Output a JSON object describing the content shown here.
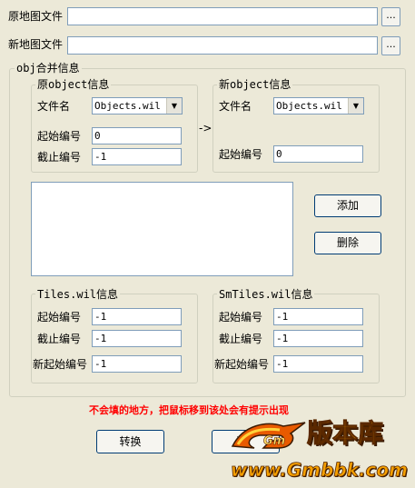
{
  "top": {
    "orig_map_label": "原地图文件",
    "new_map_label": "新地图文件",
    "orig_map_value": "",
    "new_map_value": "",
    "browse1": "...",
    "browse2": "..."
  },
  "obj_merge": {
    "title": "obj合并信息",
    "orig_object": {
      "title": "原object信息",
      "filename_label": "文件名",
      "filename_value": "Objects.wil",
      "start_label": "起始编号",
      "start_value": "0",
      "end_label": "截止编号",
      "end_value": "-1"
    },
    "arrow": "->",
    "new_object": {
      "title": "新object信息",
      "filename_label": "文件名",
      "filename_value": "Objects.wil",
      "start_label": "起始编号",
      "start_value": "0"
    },
    "add_button": "添加",
    "delete_button": "删除",
    "tiles": {
      "title": "Tiles.wil信息",
      "start_label": "起始编号",
      "start_value": "-1",
      "end_label": "截止编号",
      "end_value": "-1",
      "newstart_label": "新起始编号",
      "newstart_value": "-1"
    },
    "smtiles": {
      "title": "SmTiles.wil信息",
      "start_label": "起始编号",
      "start_value": "-1",
      "end_label": "截止编号",
      "end_value": "-1",
      "newstart_label": "新起始编号",
      "newstart_value": "-1"
    }
  },
  "hint": "不会填的地方，把鼠标移到该处会有提示出现",
  "convert_button": "转换",
  "exit_button_partial": "退",
  "watermark": {
    "brand": "版本库",
    "url": "www.Gmbbk.com"
  },
  "colors": {
    "background": "#ECE9D8",
    "hint_red": "#FF0000",
    "input_border": "#7F9DB9"
  }
}
